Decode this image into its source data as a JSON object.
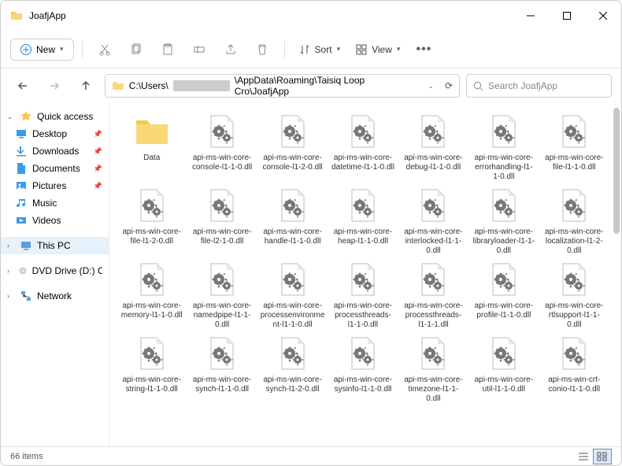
{
  "window": {
    "title": "JoafjApp"
  },
  "toolbar": {
    "new_label": "New",
    "sort_label": "Sort",
    "view_label": "View"
  },
  "path": {
    "prefix": "C:\\Users\\",
    "redacted": "████████",
    "suffix": "\\AppData\\Roaming\\Taisiq Loop Cro\\JoafjApp"
  },
  "search": {
    "placeholder": "Search JoafjApp"
  },
  "sidebar": {
    "quick": "Quick access",
    "items": [
      {
        "label": "Desktop",
        "icon": "desktop",
        "pin": true
      },
      {
        "label": "Downloads",
        "icon": "downloads",
        "pin": true
      },
      {
        "label": "Documents",
        "icon": "documents",
        "pin": true
      },
      {
        "label": "Pictures",
        "icon": "pictures",
        "pin": true
      },
      {
        "label": "Music",
        "icon": "music",
        "pin": false
      },
      {
        "label": "Videos",
        "icon": "videos",
        "pin": false
      }
    ],
    "thispc": "This PC",
    "dvd": "DVD Drive (D:) CCCC",
    "network": "Network"
  },
  "files": [
    {
      "name": "Data",
      "type": "folder"
    },
    {
      "name": "api-ms-win-core-console-l1-1-0.dll",
      "type": "dll"
    },
    {
      "name": "api-ms-win-core-console-l1-2-0.dll",
      "type": "dll"
    },
    {
      "name": "api-ms-win-core-datetime-l1-1-0.dll",
      "type": "dll"
    },
    {
      "name": "api-ms-win-core-debug-l1-1-0.dll",
      "type": "dll"
    },
    {
      "name": "api-ms-win-core-errorhandling-l1-1-0.dll",
      "type": "dll"
    },
    {
      "name": "api-ms-win-core-file-l1-1-0.dll",
      "type": "dll"
    },
    {
      "name": "api-ms-win-core-file-l1-2-0.dll",
      "type": "dll"
    },
    {
      "name": "api-ms-win-core-file-l2-1-0.dll",
      "type": "dll"
    },
    {
      "name": "api-ms-win-core-handle-l1-1-0.dll",
      "type": "dll"
    },
    {
      "name": "api-ms-win-core-heap-l1-1-0.dll",
      "type": "dll"
    },
    {
      "name": "api-ms-win-core-interlocked-l1-1-0.dll",
      "type": "dll"
    },
    {
      "name": "api-ms-win-core-libraryloader-l1-1-0.dll",
      "type": "dll"
    },
    {
      "name": "api-ms-win-core-localization-l1-2-0.dll",
      "type": "dll"
    },
    {
      "name": "api-ms-win-core-memory-l1-1-0.dll",
      "type": "dll"
    },
    {
      "name": "api-ms-win-core-namedpipe-l1-1-0.dll",
      "type": "dll"
    },
    {
      "name": "api-ms-win-core-processenvironment-l1-1-0.dll",
      "type": "dll"
    },
    {
      "name": "api-ms-win-core-processthreads-l1-1-0.dll",
      "type": "dll"
    },
    {
      "name": "api-ms-win-core-processthreads-l1-1-1.dll",
      "type": "dll"
    },
    {
      "name": "api-ms-win-core-profile-l1-1-0.dll",
      "type": "dll"
    },
    {
      "name": "api-ms-win-core-rtlsupport-l1-1-0.dll",
      "type": "dll"
    },
    {
      "name": "api-ms-win-core-string-l1-1-0.dll",
      "type": "dll"
    },
    {
      "name": "api-ms-win-core-synch-l1-1-0.dll",
      "type": "dll"
    },
    {
      "name": "api-ms-win-core-synch-l1-2-0.dll",
      "type": "dll"
    },
    {
      "name": "api-ms-win-core-sysinfo-l1-1-0.dll",
      "type": "dll"
    },
    {
      "name": "api-ms-win-core-timezone-l1-1-0.dll",
      "type": "dll"
    },
    {
      "name": "api-ms-win-core-util-l1-1-0.dll",
      "type": "dll"
    },
    {
      "name": "api-ms-win-crt-conio-l1-1-0.dll",
      "type": "dll"
    }
  ],
  "status": {
    "count": "66 items"
  }
}
